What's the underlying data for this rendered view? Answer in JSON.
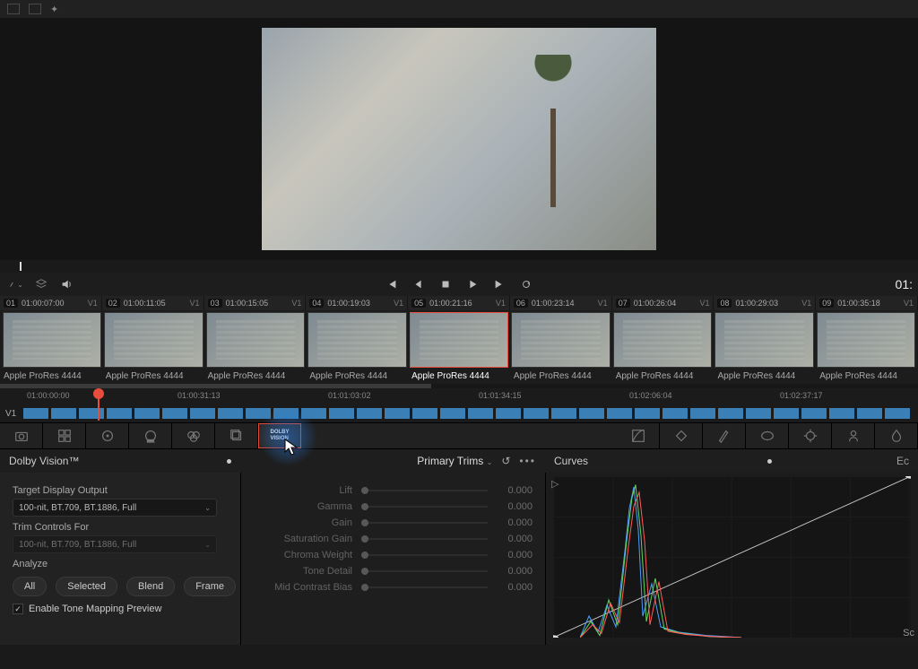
{
  "top_right_tc": "01:",
  "thumbs": [
    {
      "n": "01",
      "tc": "01:00:07:00",
      "trk": "V1",
      "label": "Apple ProRes 4444"
    },
    {
      "n": "02",
      "tc": "01:00:11:05",
      "trk": "V1",
      "label": "Apple ProRes 4444"
    },
    {
      "n": "03",
      "tc": "01:00:15:05",
      "trk": "V1",
      "label": "Apple ProRes 4444"
    },
    {
      "n": "04",
      "tc": "01:00:19:03",
      "trk": "V1",
      "label": "Apple ProRes 4444"
    },
    {
      "n": "05",
      "tc": "01:00:21:16",
      "trk": "V1",
      "label": "Apple ProRes 4444",
      "selected": true
    },
    {
      "n": "06",
      "tc": "01:00:23:14",
      "trk": "V1",
      "label": "Apple ProRes 4444"
    },
    {
      "n": "07",
      "tc": "01:00:26:04",
      "trk": "V1",
      "label": "Apple ProRes 4444"
    },
    {
      "n": "08",
      "tc": "01:00:29:03",
      "trk": "V1",
      "label": "Apple ProRes 4444"
    },
    {
      "n": "09",
      "tc": "01:00:35:18",
      "trk": "V1",
      "label": "Apple ProRes 4444"
    }
  ],
  "ruler": [
    "01:00:00:00",
    "01:00:31:13",
    "01:01:03:02",
    "01:01:34:15",
    "01:02:06:04",
    "01:02:37:17"
  ],
  "track_label": "V1",
  "dolby": {
    "title": "Dolby Vision™",
    "target_label": "Target Display Output",
    "target_value": "100-nit, BT.709, BT.1886, Full",
    "trim_label": "Trim Controls For",
    "trim_value": "100-nit, BT.709, BT.1886, Full",
    "analyze_label": "Analyze",
    "buttons": {
      "all": "All",
      "selected": "Selected",
      "blend": "Blend",
      "frame": "Frame"
    },
    "tonemap_label": "Enable Tone Mapping Preview"
  },
  "trims": {
    "header": "Primary Trims",
    "rows": [
      {
        "label": "Lift",
        "value": "0.000"
      },
      {
        "label": "Gamma",
        "value": "0.000"
      },
      {
        "label": "Gain",
        "value": "0.000"
      },
      {
        "label": "Saturation Gain",
        "value": "0.000"
      },
      {
        "label": "Chroma Weight",
        "value": "0.000"
      },
      {
        "label": "Tone Detail",
        "value": "0.000"
      },
      {
        "label": "Mid Contrast Bias",
        "value": "0.000"
      }
    ]
  },
  "curves": {
    "title": "Curves",
    "side": "Ec"
  },
  "right_side": "Sc",
  "icons": {
    "reset": "↺"
  }
}
